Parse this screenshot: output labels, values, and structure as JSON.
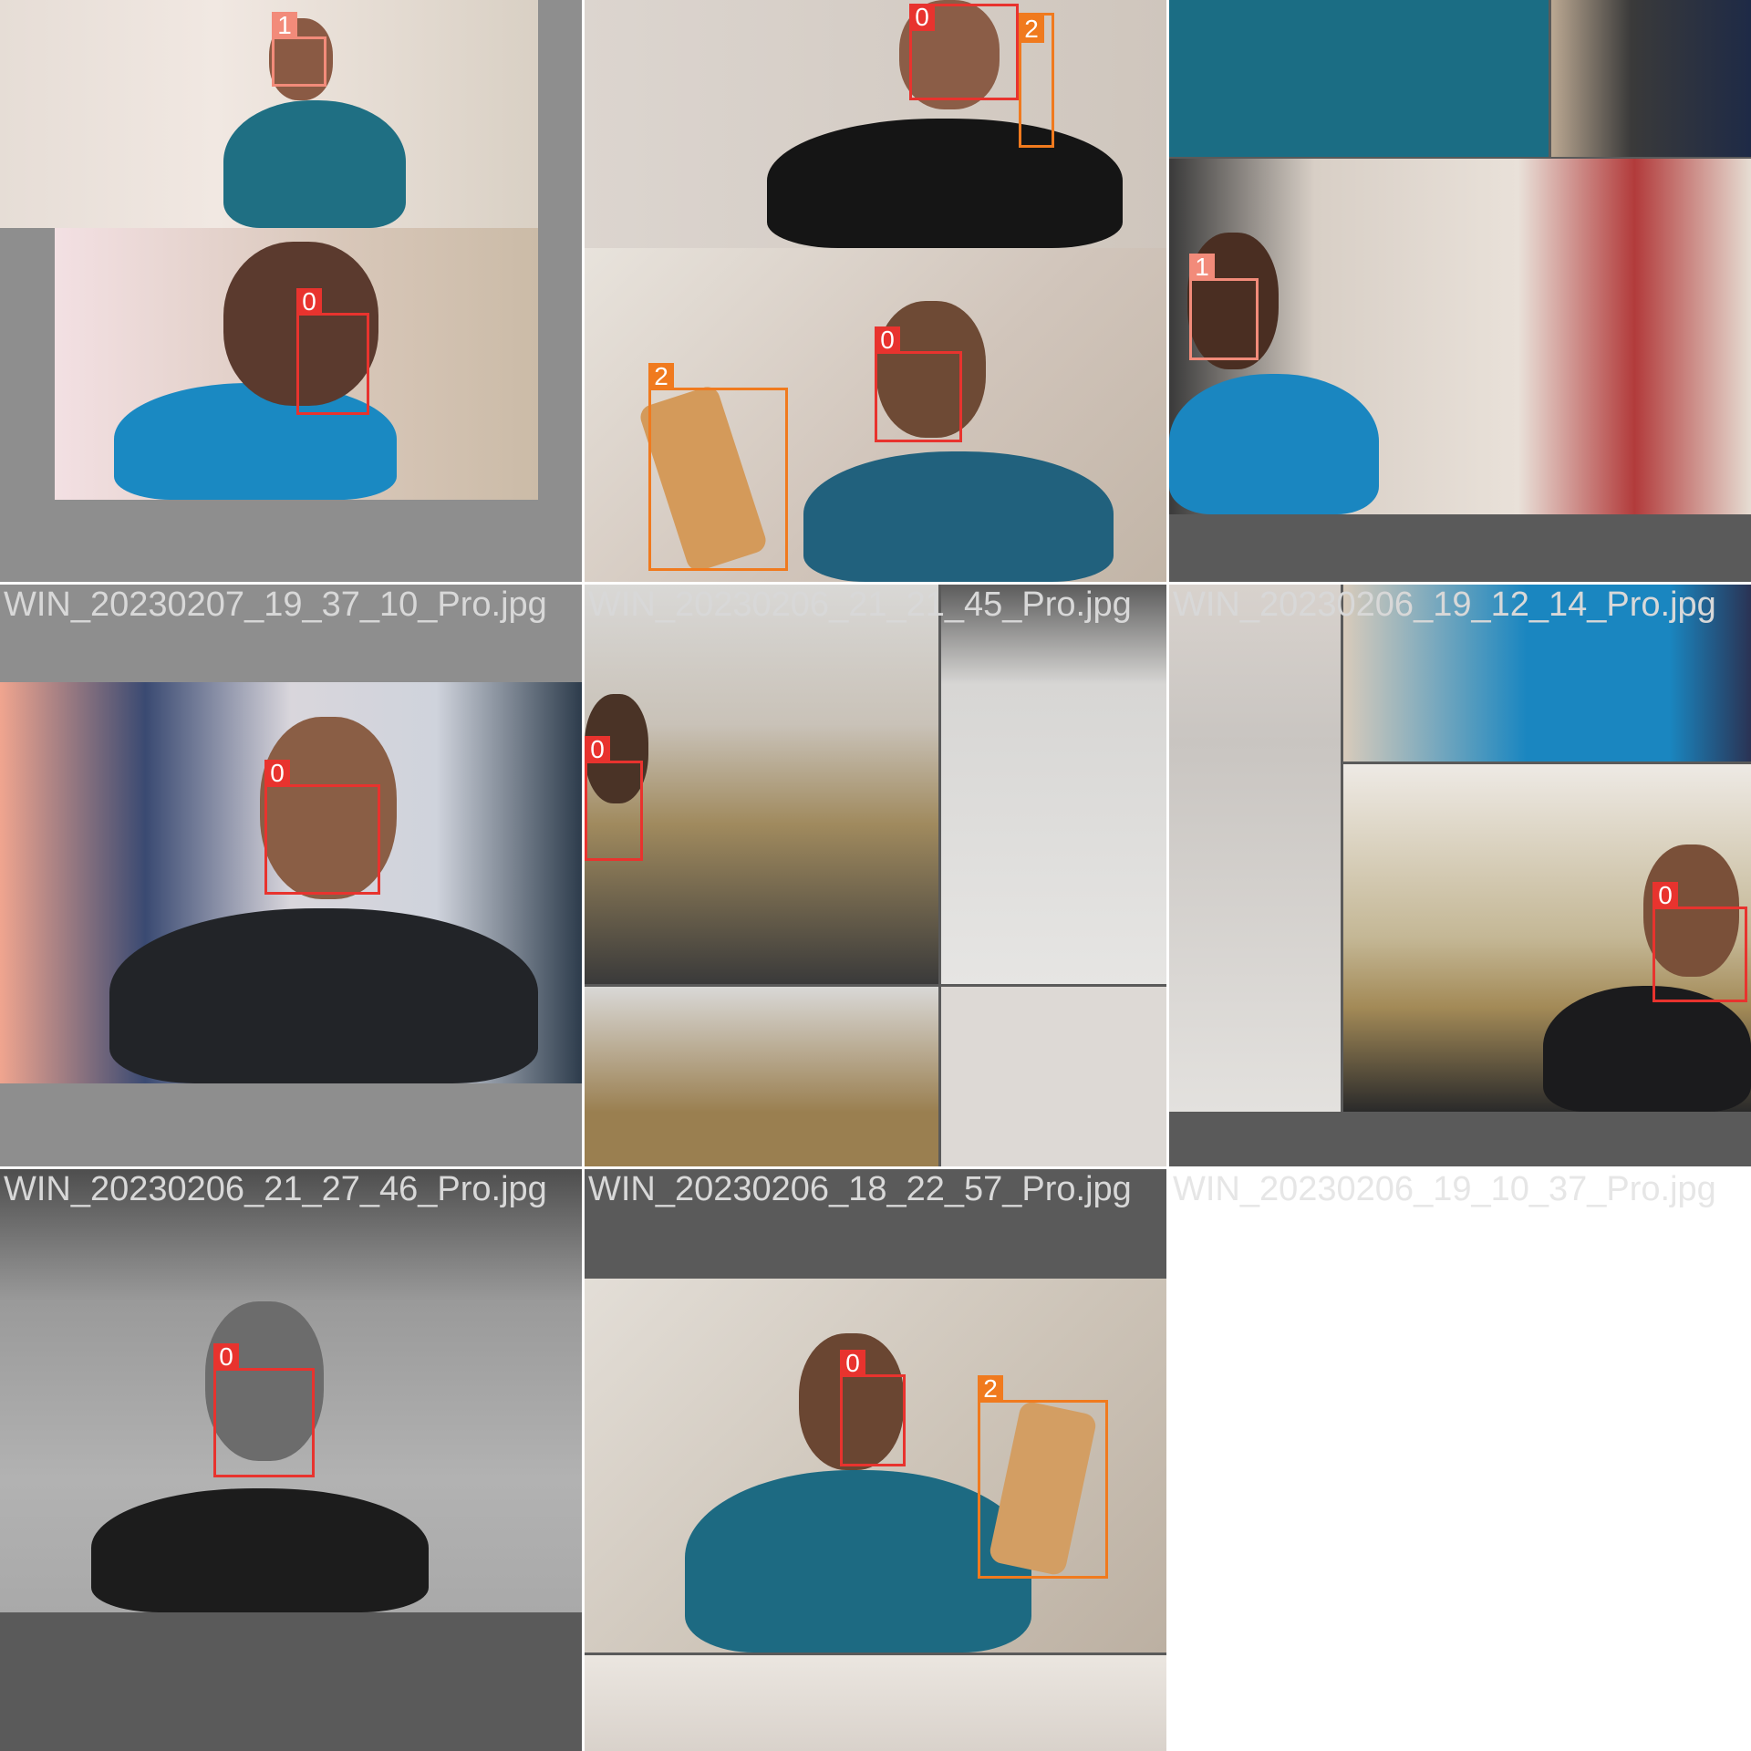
{
  "mosaics": [
    {
      "id": "t0",
      "caption": "",
      "labels": [
        "1",
        "0"
      ],
      "classes": [
        1,
        0
      ]
    },
    {
      "id": "t1",
      "caption": "",
      "labels": [
        "0",
        "2",
        "2",
        "0"
      ],
      "classes": [
        0,
        2,
        2,
        0
      ]
    },
    {
      "id": "t2",
      "caption": "",
      "labels": [
        "1"
      ],
      "classes": [
        1
      ]
    },
    {
      "id": "t3",
      "caption": "WIN_20230207_19_37_10_Pro.jpg",
      "labels": [
        "0"
      ],
      "classes": [
        0
      ]
    },
    {
      "id": "t4",
      "caption": "WIN_20230206_21_21_45_Pro.jpg",
      "labels": [
        "0"
      ],
      "classes": [
        0
      ]
    },
    {
      "id": "t5",
      "caption": "WIN_20230206_19_12_14_Pro.jpg",
      "labels": [
        "0"
      ],
      "classes": [
        0
      ]
    },
    {
      "id": "t6",
      "caption": "WIN_20230206_21_27_46_Pro.jpg",
      "labels": [
        "0"
      ],
      "classes": [
        0
      ]
    },
    {
      "id": "t7",
      "caption": "WIN_20230206_18_22_57_Pro.jpg",
      "labels": [
        "0",
        "2"
      ],
      "classes": [
        0,
        2
      ]
    }
  ],
  "trailing_caption": "WIN_20230206_19_10_37_Pro.jpg",
  "colors": {
    "class_0": "#e8332e",
    "class_1": "#f28b7a",
    "class_2": "#f07a1e",
    "pad": "#8e8e8e",
    "pad_dark": "#5a5a5a"
  }
}
